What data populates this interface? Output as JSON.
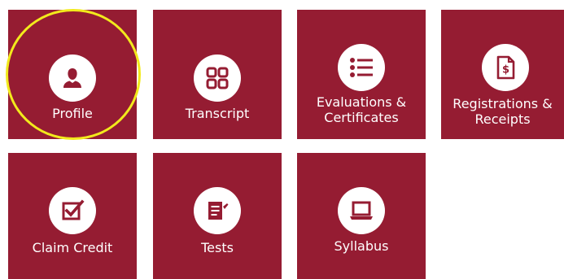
{
  "theme": {
    "tile_color": "#951c32",
    "icon_bg": "#ffffff",
    "highlight_color": "#f2ea1c"
  },
  "tiles": [
    {
      "label": "Profile",
      "icon": "person-icon"
    },
    {
      "label": "Transcript",
      "icon": "grid-icon"
    },
    {
      "label": "Evaluations & Certificates",
      "icon": "list-icon"
    },
    {
      "label": "Registrations & Receipts",
      "icon": "receipt-dollar-icon"
    },
    {
      "label": "Claim Credit",
      "icon": "checkbox-icon"
    },
    {
      "label": "Tests",
      "icon": "test-document-icon"
    },
    {
      "label": "Syllabus",
      "icon": "laptop-icon"
    }
  ]
}
